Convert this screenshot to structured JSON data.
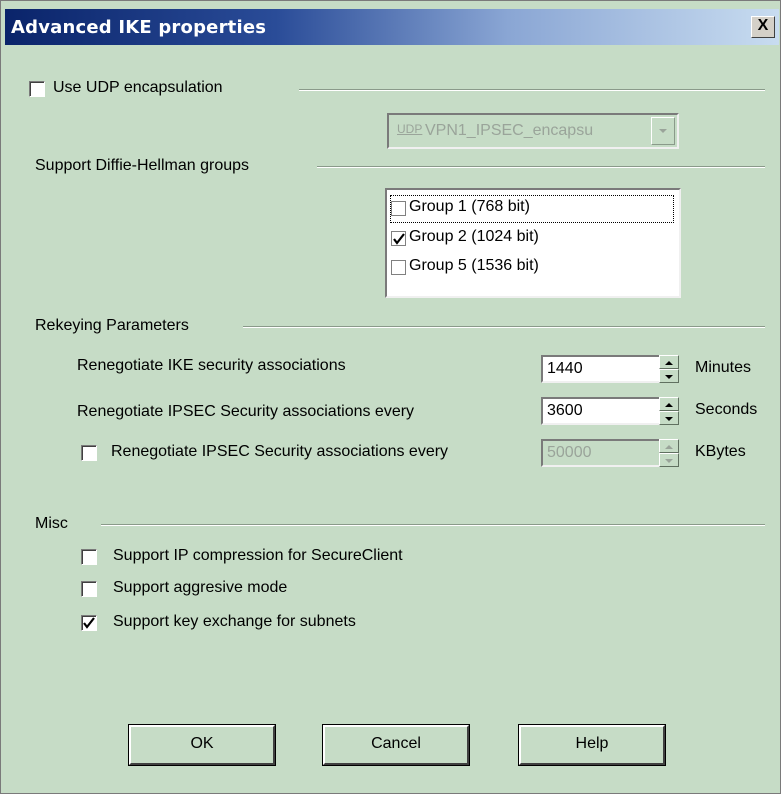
{
  "window": {
    "title": "Advanced IKE properties",
    "close_label": "X"
  },
  "udp": {
    "checkbox_label": "Use UDP encapsulation",
    "checked": false,
    "combo_tag": "UDP",
    "combo_value": "VPN1_IPSEC_encapsu"
  },
  "dh": {
    "section_label": "Support Diffie-Hellman groups",
    "groups": [
      {
        "label": "Group 1 (768 bit)",
        "checked": false
      },
      {
        "label": "Group 2 (1024 bit)",
        "checked": true
      },
      {
        "label": "Group 5 (1536 bit)",
        "checked": false
      }
    ]
  },
  "rekey": {
    "section_label": "Rekeying Parameters",
    "ike_label": "Renegotiate IKE security associations",
    "ike_value": "1440",
    "ike_unit": "Minutes",
    "ipsec_label": "Renegotiate IPSEC Security associations every",
    "ipsec_value": "3600",
    "ipsec_unit": "Seconds",
    "kb_label": "Renegotiate IPSEC Security associations every",
    "kb_checked": false,
    "kb_value": "50000",
    "kb_unit": "KBytes"
  },
  "misc": {
    "section_label": "Misc",
    "items": [
      {
        "label": "Support IP compression for SecureClient",
        "checked": false
      },
      {
        "label": "Support aggresive mode",
        "checked": false
      },
      {
        "label": "Support key exchange for subnets",
        "checked": true
      }
    ]
  },
  "buttons": {
    "ok": "OK",
    "cancel": "Cancel",
    "help": "Help"
  },
  "colors": {
    "dialog_bg": "#c6dcc6",
    "titlebar_start": "#0a246a",
    "titlebar_end": "#c8dcf0",
    "disabled_text": "#9aa49a"
  },
  "icons": [
    "close-icon",
    "check-icon",
    "chevron-down-icon",
    "spin-up-icon",
    "spin-down-icon"
  ]
}
